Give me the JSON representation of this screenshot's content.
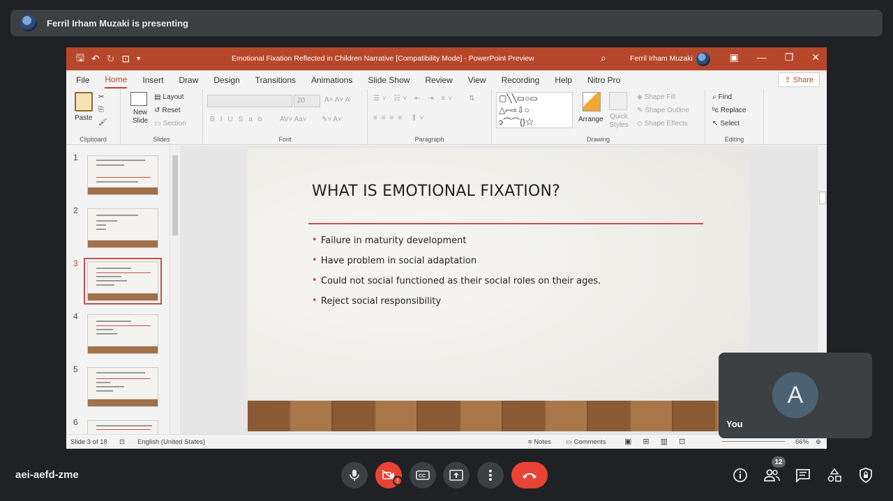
{
  "presenting": {
    "text": "Ferril Irham Muzaki is presenting"
  },
  "ppt": {
    "window_title": "Emotional Fixation Reflected in Children Narrative [Compatibility Mode]  -  PowerPoint Preview",
    "user_name": "Ferril Irham Muzaki",
    "menu": [
      "File",
      "Home",
      "Insert",
      "Draw",
      "Design",
      "Transitions",
      "Animations",
      "Slide Show",
      "Review",
      "View",
      "Recording",
      "Help",
      "Nitro Pro"
    ],
    "share_label": "Share",
    "ribbon": {
      "clipboard": {
        "label": "Clipboard",
        "paste": "Paste"
      },
      "slides": {
        "label": "Slides",
        "new_slide": "New Slide",
        "layout": "Layout",
        "reset": "Reset",
        "section": "Section"
      },
      "font": {
        "label": "Font",
        "size": "20"
      },
      "paragraph": {
        "label": "Paragraph"
      },
      "drawing": {
        "label": "Drawing",
        "arrange": "Arrange",
        "quick_styles": "Quick Styles",
        "shape_fill": "Shape Fill",
        "shape_outline": "Shape Outline",
        "shape_effects": "Shape Effects"
      },
      "editing": {
        "label": "Editing",
        "find": "Find",
        "replace": "Replace",
        "select": "Select"
      }
    },
    "thumbnails": [
      "1",
      "2",
      "3",
      "4",
      "5",
      "6"
    ],
    "active_slide": 3,
    "slide": {
      "title": "WHAT IS EMOTIONAL FIXATION?",
      "bullets": [
        "Failure in maturity development",
        "Have problem in social adaptation",
        "Could not social functioned as their social roles on their ages.",
        "Reject social responsibility"
      ]
    },
    "status": {
      "slide_count": "Slide 3 of 18",
      "language": "English (United States)",
      "notes": "Notes",
      "comments": "Comments",
      "zoom": "66%"
    }
  },
  "self_tile": {
    "initial": "A",
    "name": "You"
  },
  "meeting_code": "aei-aefd-zme",
  "participants_count": "12",
  "colors": {
    "accent_ppt": "#b7472a",
    "end_call": "#ea4335",
    "bg": "#202124"
  }
}
